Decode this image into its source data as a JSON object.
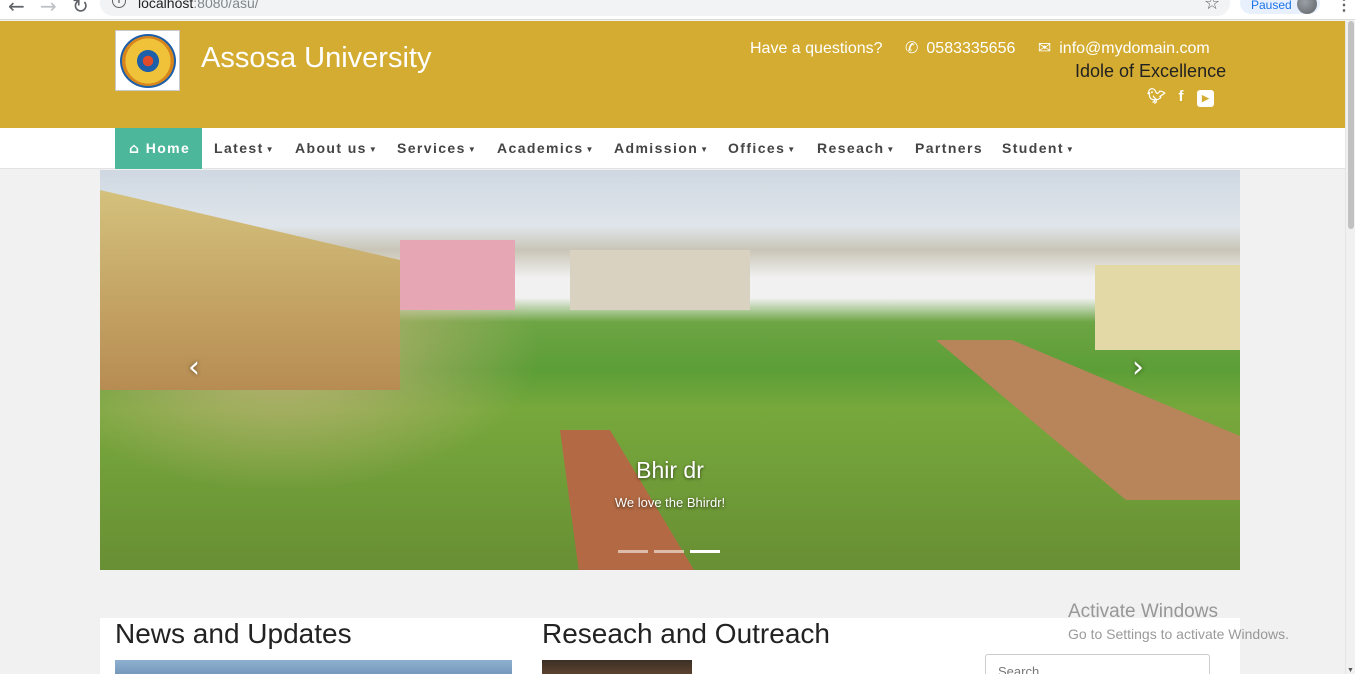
{
  "browser": {
    "url_host": "localhost",
    "url_rest": ":8080/asu/",
    "paused_label": "Paused"
  },
  "header": {
    "title": "Assosa University",
    "question": "Have a questions?",
    "phone": "0583335656",
    "email": "info@mydomain.com",
    "motto": "Idole of Excellence",
    "social": [
      "twitter-icon",
      "facebook-icon",
      "youtube-icon"
    ]
  },
  "nav": {
    "items": [
      {
        "label": "Home",
        "dropdown": false,
        "active": true
      },
      {
        "label": "Latest",
        "dropdown": true
      },
      {
        "label": "About us",
        "dropdown": true
      },
      {
        "label": "Services",
        "dropdown": true
      },
      {
        "label": "Academics",
        "dropdown": true
      },
      {
        "label": "Admission",
        "dropdown": true
      },
      {
        "label": "Offices",
        "dropdown": true
      },
      {
        "label": "Reseach",
        "dropdown": true
      },
      {
        "label": "Partners",
        "dropdown": false
      },
      {
        "label": "Student",
        "dropdown": true
      }
    ]
  },
  "carousel": {
    "caption_title": "Bhir dr",
    "caption_text": "We love the Bhirdr!",
    "slide_count": 3,
    "active_index": 2
  },
  "content": {
    "news_title": "News and Updates",
    "research_title": "Reseach and Outreach",
    "search_placeholder": "Search"
  },
  "watermark": {
    "line1": "Activate Windows",
    "line2": "Go to Settings to activate Windows."
  },
  "colors": {
    "header_bg": "#d3ac31",
    "nav_active": "#4db79b"
  }
}
